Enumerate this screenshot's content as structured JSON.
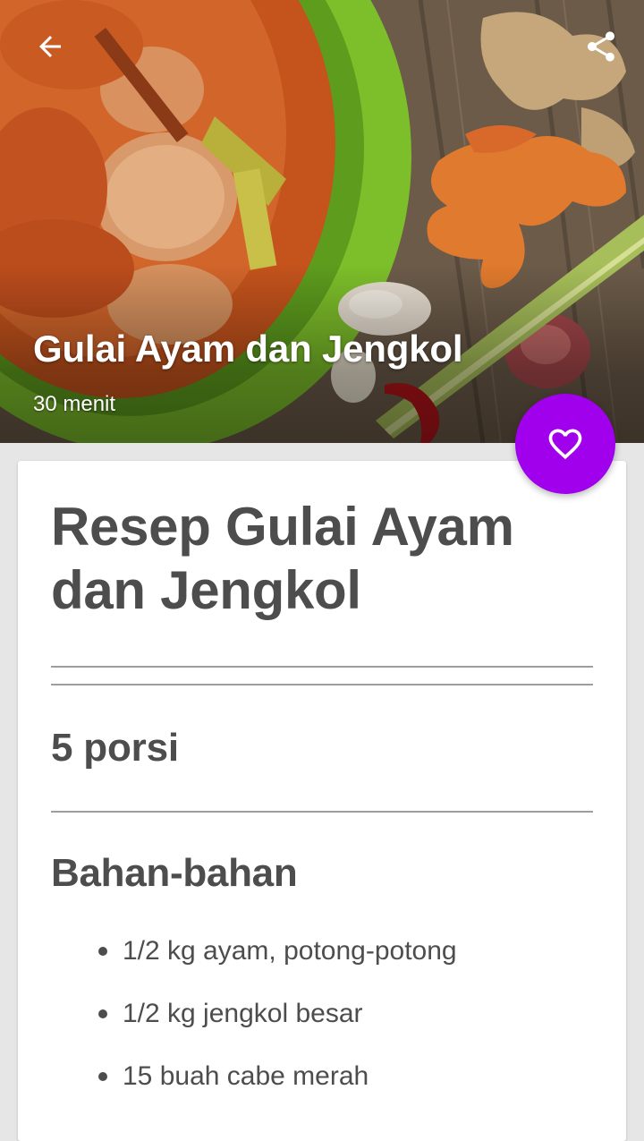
{
  "hero": {
    "title": "Gulai Ayam dan Jengkol",
    "time": "30 menit"
  },
  "toolbar": {
    "back_icon": "arrow-left-icon",
    "share_icon": "share-icon"
  },
  "favorite": {
    "icon": "heart-outline-icon",
    "color": "#a100ec"
  },
  "recipe": {
    "title": "Resep Gulai Ayam dan Jengkol",
    "portions": "5 porsi",
    "ingredients_heading": "Bahan-bahan",
    "ingredients": [
      "1/2 kg ayam, potong-potong",
      "1/2 kg jengkol besar",
      "15 buah cabe merah"
    ]
  }
}
